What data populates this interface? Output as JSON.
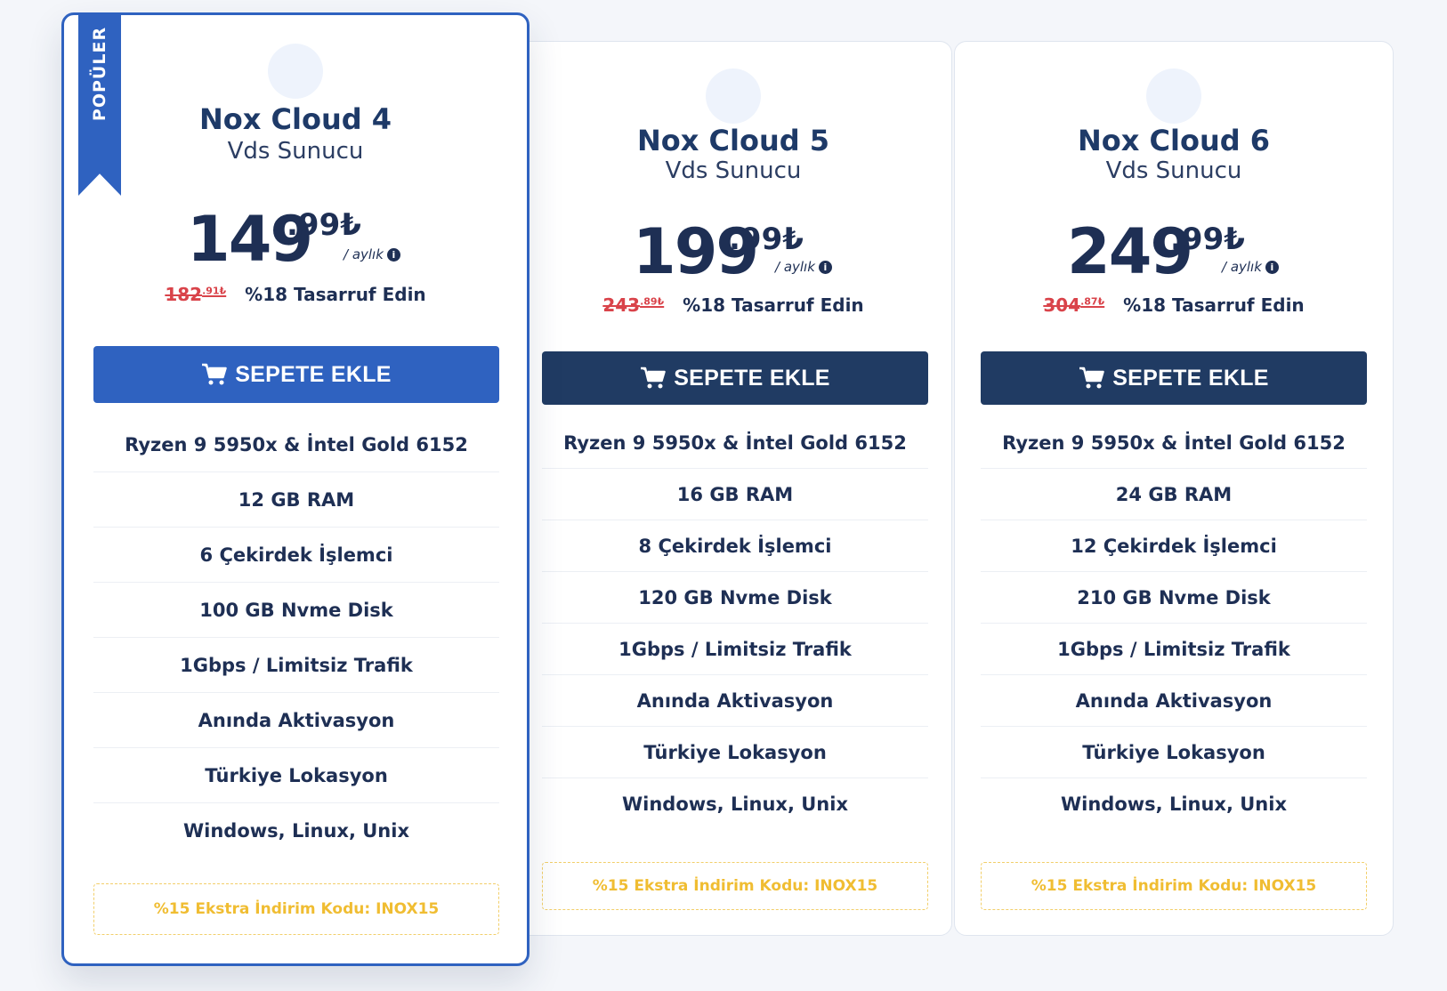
{
  "plans": [
    {
      "badge": "POPÜLER",
      "name": "Nox Cloud 4",
      "subtitle": "Vds Sunucu",
      "price_main": "149",
      "price_cents": ".99₺",
      "period": "/ aylık",
      "old_price_main": "182",
      "old_price_cents": ".91₺",
      "savings": "%18 Tasarruf Edin",
      "cta": "SEPETE EKLE",
      "features": [
        "Ryzen 9 5950x & İntel Gold 6152",
        "12 GB RAM",
        "6 Çekirdek İşlemci",
        "100 GB Nvme Disk",
        "1Gbps / Limitsiz Trafik",
        "Anında Aktivasyon",
        "Türkiye Lokasyon",
        "Windows, Linux, Unix"
      ],
      "promo": "%15 Ekstra İndirim Kodu: INOX15"
    },
    {
      "name": "Nox Cloud 5",
      "subtitle": "Vds Sunucu",
      "price_main": "199",
      "price_cents": ".99₺",
      "period": "/ aylık",
      "old_price_main": "243",
      "old_price_cents": ".89₺",
      "savings": "%18 Tasarruf Edin",
      "cta": "SEPETE EKLE",
      "features": [
        "Ryzen 9 5950x & İntel Gold 6152",
        "16 GB RAM",
        "8 Çekirdek İşlemci",
        "120 GB Nvme Disk",
        "1Gbps / Limitsiz Trafik",
        "Anında Aktivasyon",
        "Türkiye Lokasyon",
        "Windows, Linux, Unix"
      ],
      "promo": "%15 Ekstra İndirim Kodu: INOX15"
    },
    {
      "name": "Nox Cloud 6",
      "subtitle": "Vds Sunucu",
      "price_main": "249",
      "price_cents": ".99₺",
      "period": "/ aylık",
      "old_price_main": "304",
      "old_price_cents": ".87₺",
      "savings": "%18 Tasarruf Edin",
      "cta": "SEPETE EKLE",
      "features": [
        "Ryzen 9 5950x & İntel Gold 6152",
        "24 GB RAM",
        "12 Çekirdek İşlemci",
        "210 GB Nvme Disk",
        "1Gbps / Limitsiz Trafik",
        "Anında Aktivasyon",
        "Türkiye Lokasyon",
        "Windows, Linux, Unix"
      ],
      "promo": "%15 Ekstra İndirim Kodu: INOX15"
    }
  ],
  "icons": {
    "cart": "shopping-cart-icon",
    "info": "info-icon"
  },
  "colors": {
    "primary": "#2f62c0",
    "dark": "#203b63",
    "text": "#1e2f54",
    "strike": "#d9434a",
    "promo": "#f0bd32"
  }
}
